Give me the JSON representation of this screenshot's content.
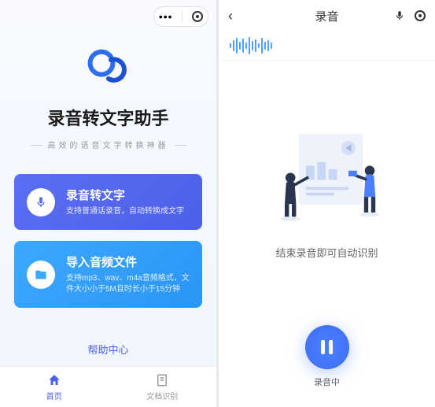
{
  "home": {
    "app_title": "录音转文字助手",
    "app_subtitle": "高效的语音文字转换神器",
    "cards": [
      {
        "title": "录音转文字",
        "desc": "支持普通话录音，自动转换成文字"
      },
      {
        "title": "导入音频文件",
        "desc": "支持mp3、wav、m4a音频格式，文件大小小于5M且时长小于15分钟"
      }
    ],
    "help_link": "帮助中心",
    "tabs": [
      {
        "label": "首页"
      },
      {
        "label": "文档识别"
      }
    ]
  },
  "rec": {
    "title": "录音",
    "hint": "结束录音即可自动识别",
    "status": "录音中"
  }
}
